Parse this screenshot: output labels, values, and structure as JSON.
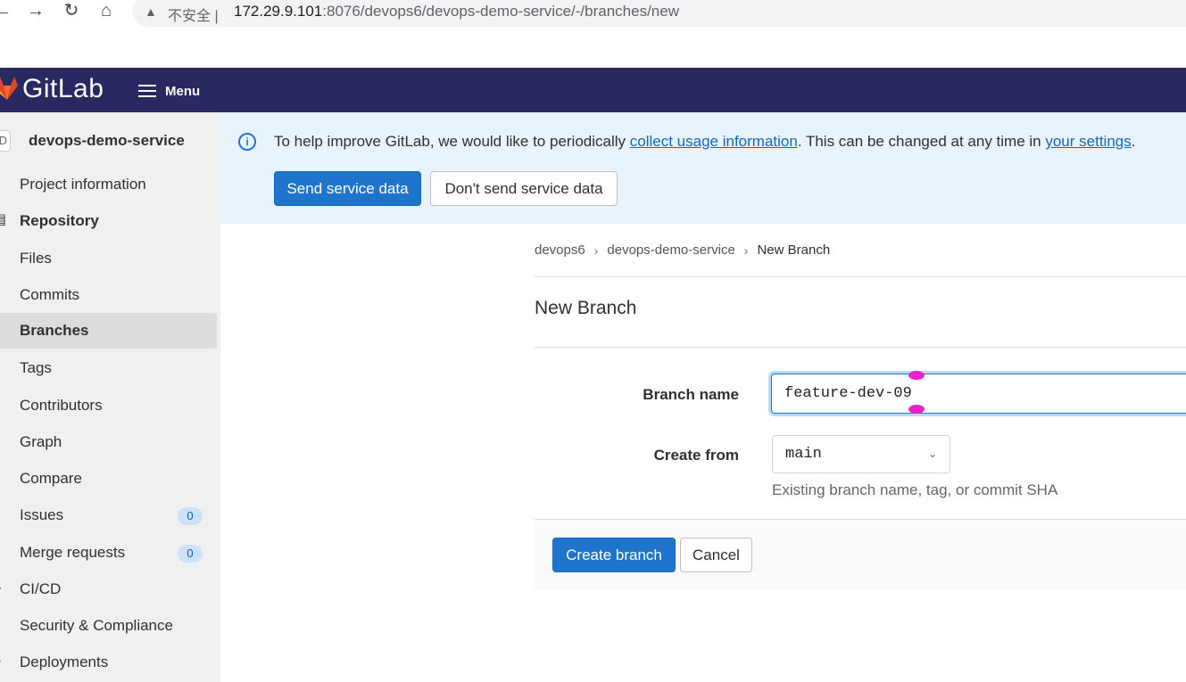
{
  "browser": {
    "back": "←",
    "forward": "→",
    "reload": "↻",
    "home": "⌂",
    "security_label": "不安全",
    "url_host": "172.29.9.101",
    "url_rest": ":8076/devops6/devops-demo-service/-/branches/new"
  },
  "topbar": {
    "logo_text": "GitLab",
    "menu_label": "Menu"
  },
  "sidebar": {
    "project_initial": "D",
    "project_name": "devops-demo-service",
    "items": [
      {
        "label": "Project information",
        "icon": "info-book-icon"
      },
      {
        "label": "Repository",
        "icon": "repository-icon"
      },
      {
        "label": "Files"
      },
      {
        "label": "Commits"
      },
      {
        "label": "Branches"
      },
      {
        "label": "Tags"
      },
      {
        "label": "Contributors"
      },
      {
        "label": "Graph"
      },
      {
        "label": "Compare"
      },
      {
        "label": "Issues",
        "icon": "issues-icon",
        "count": "0"
      },
      {
        "label": "Merge requests",
        "icon": "merge-request-icon",
        "count": "0"
      },
      {
        "label": "CI/CD",
        "icon": "rocket-icon"
      },
      {
        "label": "Security & Compliance",
        "icon": "shield-icon"
      },
      {
        "label": "Deployments",
        "icon": "deployments-icon"
      }
    ]
  },
  "banner": {
    "text_before": "To help improve GitLab, we would like to periodically ",
    "link1": "collect usage information",
    "text_middle": ". This can be changed at any time in ",
    "link2": "your settings",
    "text_after": ".",
    "send_button": "Send service data",
    "dont_send_button": "Don't send service data"
  },
  "breadcrumb": {
    "items": [
      "devops6",
      "devops-demo-service",
      "New Branch"
    ],
    "separator": "›"
  },
  "page_title": "New Branch",
  "form": {
    "branch_name_label": "Branch name",
    "branch_name_value": "feature-dev-09",
    "create_from_label": "Create from",
    "create_from_value": "main",
    "create_from_help": "Existing branch name, tag, or commit SHA",
    "create_button": "Create branch",
    "cancel_button": "Cancel"
  },
  "colors": {
    "topbar": "#292961",
    "primary": "#1f75cb",
    "banner_bg": "#e9f3fc",
    "sidebar_bg": "#f0f0f0"
  }
}
